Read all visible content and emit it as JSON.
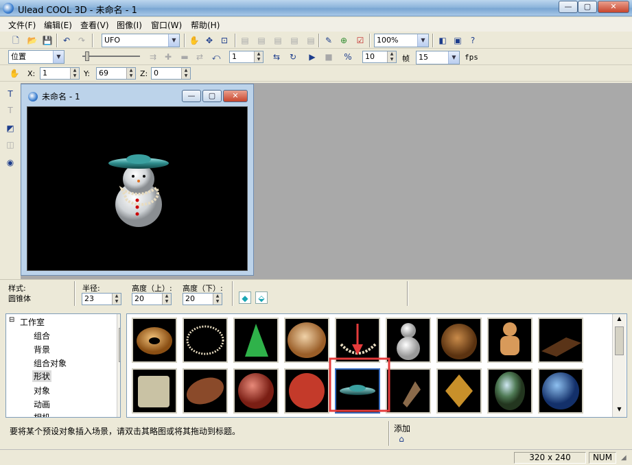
{
  "app": {
    "title": "Ulead COOL 3D - 未命名 - 1"
  },
  "window_controls": {
    "minimize": "—",
    "maximize": "▢",
    "close": "✕"
  },
  "menu": [
    "文件(F)",
    "编辑(E)",
    "查看(V)",
    "图像(I)",
    "窗口(W)",
    "帮助(H)"
  ],
  "toolbar1": {
    "object_select": "UFO",
    "zoom": "100%"
  },
  "toolbar2": {
    "mode_select": "位置",
    "frame_value": "1",
    "frames_value": "10",
    "frames_label": "帧",
    "fps_value": "15",
    "fps_label": "fps"
  },
  "toolbar3": {
    "x_label": "X:",
    "x_value": "1",
    "y_label": "Y:",
    "y_value": "69",
    "z_label": "Z:",
    "z_value": "0"
  },
  "document": {
    "title": "未命名 - 1"
  },
  "properties": {
    "style_label": "样式:",
    "style_value": "圆锥体",
    "radius_label": "半径:",
    "radius_value": "23",
    "height_top_label": "高度（上）:",
    "height_top_value": "20",
    "height_bottom_label": "高度（下）:",
    "height_bottom_value": "20"
  },
  "tree": {
    "root": "工作室",
    "items": [
      "组合",
      "背景",
      "组合对象",
      "形状",
      "对象",
      "动画",
      "相机"
    ],
    "selected": "形状"
  },
  "gallery": {
    "thumbnails": [
      "donut",
      "ring",
      "cone",
      "bread",
      "pearl-necklace",
      "snowman",
      "bear-head",
      "gingerbread",
      "chocolate-bar",
      "esc-key",
      "football",
      "basketball",
      "beach-ball",
      "ufo",
      "shell",
      "tribal-face",
      "egg-landscape",
      "earth"
    ],
    "selected": "ufo"
  },
  "hint": {
    "text": "要将某个预设对象插入场景，请双击其略图或将其拖动到标题。"
  },
  "add": {
    "label": "添加"
  },
  "status": {
    "dimensions": "320 x 240",
    "num": "NUM"
  },
  "colors": {
    "highlight": "#e53b3b",
    "selection": "#3a6fc2"
  }
}
